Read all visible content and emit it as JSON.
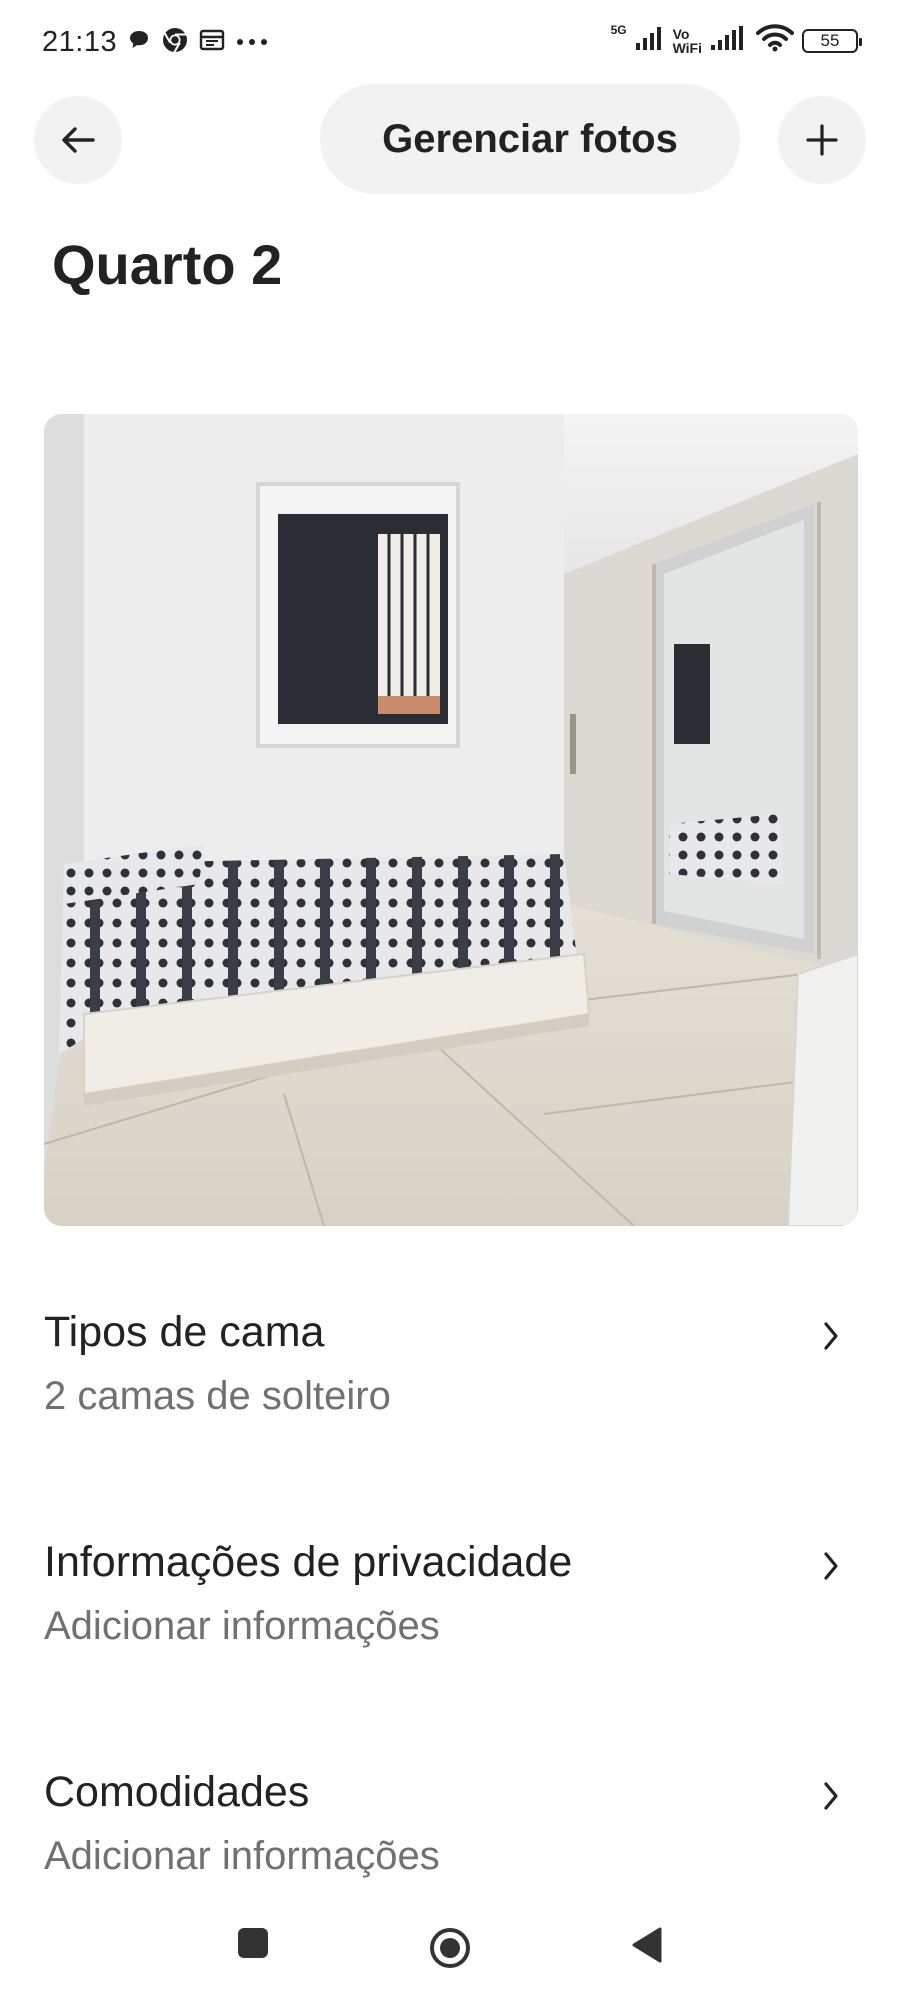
{
  "status_bar": {
    "time": "21:13",
    "network": "5G",
    "vowifi_top": "Vo",
    "vowifi_bottom": "WiFi",
    "battery": "55",
    "icons": [
      "chat-bubble-icon",
      "chrome-icon",
      "calendar-icon",
      "more-dots-icon",
      "signal-icon",
      "wifi-icon",
      "battery-icon"
    ]
  },
  "header": {
    "title": "Gerenciar fotos",
    "back_icon": "arrow-left-icon",
    "add_icon": "plus-icon"
  },
  "page": {
    "title": "Quarto 2"
  },
  "photo": {
    "description_icon": "room-photo"
  },
  "list": [
    {
      "title": "Tipos de cama",
      "subtitle": "2 camas de solteiro"
    },
    {
      "title": "Informações de privacidade",
      "subtitle": "Adicionar informações"
    },
    {
      "title": "Comodidades",
      "subtitle": "Adicionar informações"
    }
  ],
  "nav_bar": {
    "icons": [
      "recents-square-icon",
      "home-circle-icon",
      "back-triangle-icon"
    ]
  },
  "colors": {
    "text_primary": "#222222",
    "text_secondary": "#717171",
    "pill_background": "#f2f2f2"
  }
}
